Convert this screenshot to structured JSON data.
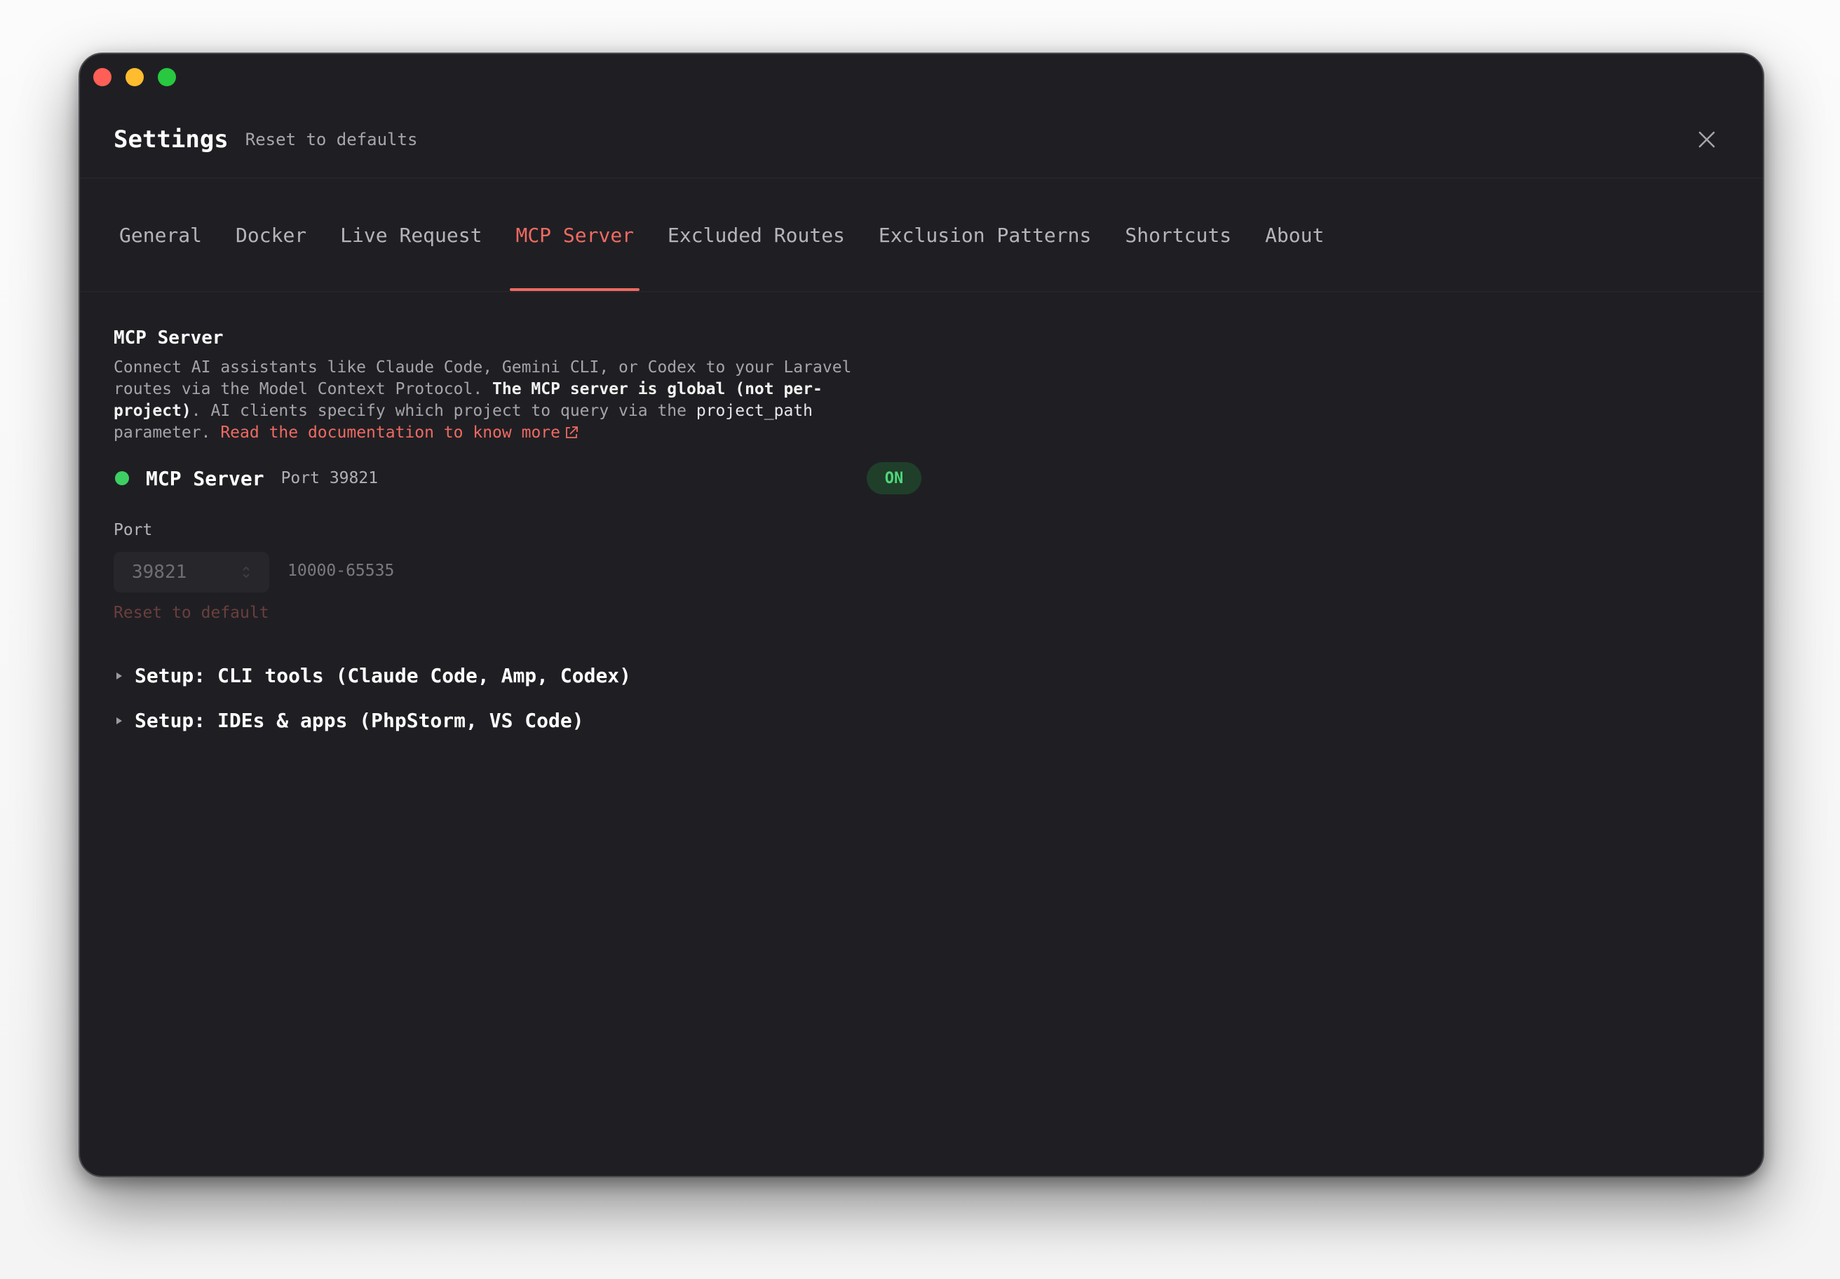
{
  "window": {
    "title": "Settings",
    "reset_all_label": "Reset to defaults"
  },
  "tabs": [
    {
      "label": "General",
      "active": false
    },
    {
      "label": "Docker",
      "active": false
    },
    {
      "label": "Live Request",
      "active": false
    },
    {
      "label": "MCP Server",
      "active": true
    },
    {
      "label": "Excluded Routes",
      "active": false
    },
    {
      "label": "Exclusion Patterns",
      "active": false
    },
    {
      "label": "Shortcuts",
      "active": false
    },
    {
      "label": "About",
      "active": false
    }
  ],
  "section": {
    "title": "MCP Server",
    "desc_part1": "Connect AI assistants like Claude Code, Gemini CLI, or Codex to your Laravel routes via the Model Context Protocol. ",
    "desc_bold": "The MCP server is global (not per-project)",
    "desc_part2": ". AI clients specify which project to query via the ",
    "desc_code": "project_path",
    "desc_part3": " parameter. ",
    "doc_link_label": "Read the documentation to know more"
  },
  "server": {
    "name": "MCP Server",
    "port_text": "Port 39821",
    "toggle_label": "ON",
    "status_color": "#3ecf63"
  },
  "port": {
    "label": "Port",
    "value": "39821",
    "range": "10000-65535",
    "reset_label": "Reset to default"
  },
  "setup": [
    {
      "label": "Setup: CLI tools (Claude Code, Amp, Codex)"
    },
    {
      "label": "Setup: IDEs & apps (PhpStorm, VS Code)"
    }
  ],
  "colors": {
    "accent": "#ef6a62",
    "background": "#1f1f23",
    "on_green": "#4fd67a"
  },
  "icons": {
    "close": "close-icon",
    "external_link": "external-link-icon",
    "stepper": "stepper-icon",
    "disclosure": "disclosure-triangle-icon"
  }
}
